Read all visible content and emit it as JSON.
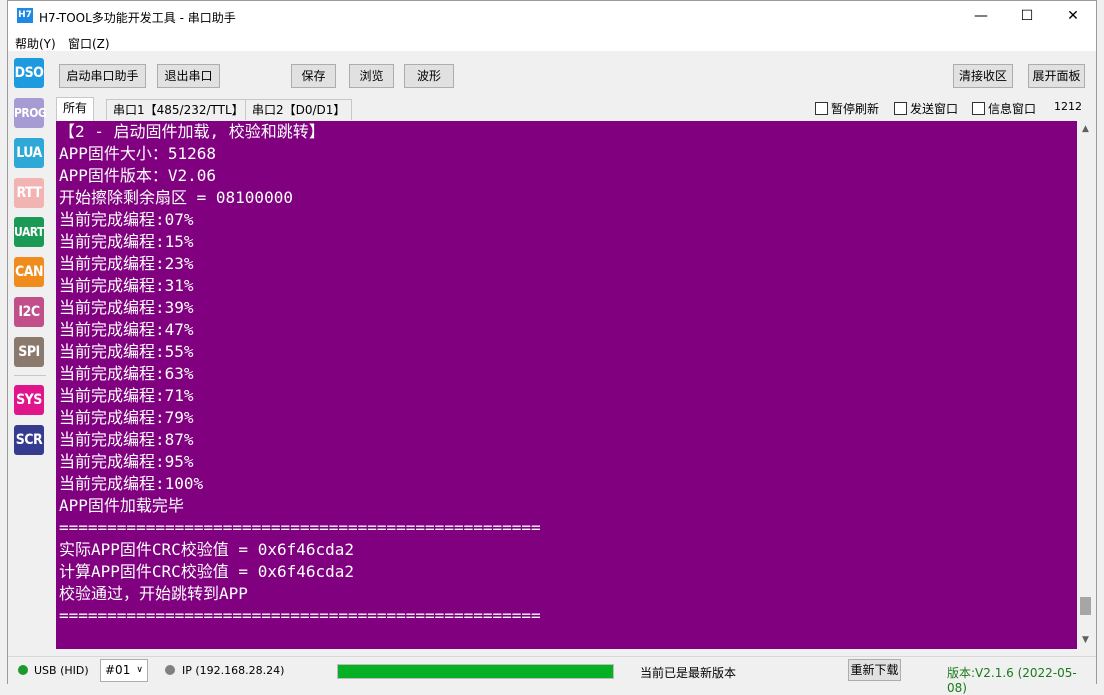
{
  "window": {
    "icon_text": "H7",
    "title": "H7-TOOL多功能开发工具 - 串口助手",
    "minimize": "—",
    "maximize": "☐",
    "close": "✕"
  },
  "menu": [
    "帮助(Y)",
    "窗口(Z)"
  ],
  "sidebar": [
    {
      "label": "DSO",
      "color": "#1e9be0"
    },
    {
      "label": "PROG",
      "color": "#a79bd4"
    },
    {
      "label": "LUA",
      "color": "#2ea8d6"
    },
    {
      "label": "RTT",
      "color": "#f2b3b3"
    },
    {
      "label": "UART",
      "color": "#1a9a55"
    },
    {
      "label": "CAN",
      "color": "#f08c1e"
    },
    {
      "label": "I2C",
      "color": "#c04f8a"
    },
    {
      "label": "SPI",
      "color": "#8a7a6e"
    },
    {
      "label": "SYS",
      "color": "#e0158c"
    },
    {
      "label": "SCR",
      "color": "#353c8f"
    }
  ],
  "toolbar": {
    "start": "启动串口助手",
    "exit": "退出串口",
    "save": "保存",
    "browse": "浏览",
    "wave": "波形",
    "clear": "清接收区",
    "expand": "展开面板"
  },
  "tabs": [
    "所有",
    "串口1【485/232/TTL】",
    "串口2【D0/D1】"
  ],
  "options": {
    "pause": "暂停刷新",
    "send_window": "发送窗口",
    "info_window": "信息窗口",
    "count": "1212"
  },
  "console": {
    "background": "#800080",
    "lines": [
      "【2 - 启动固件加载, 校验和跳转】",
      "APP固件大小：51268",
      "APP固件版本：V2.06",
      "开始擦除剩余扇区 = 08100000",
      "当前完成编程:07%",
      "当前完成编程:15%",
      "当前完成编程:23%",
      "当前完成编程:31%",
      "当前完成编程:39%",
      "当前完成编程:47%",
      "当前完成编程:55%",
      "当前完成编程:63%",
      "当前完成编程:71%",
      "当前完成编程:79%",
      "当前完成编程:87%",
      "当前完成编程:95%",
      "当前完成编程:100%",
      "APP固件加载完毕",
      "==================================================",
      "实际APP固件CRC校验值 = 0x6f46cda2",
      "计算APP固件CRC校验值 = 0x6f46cda2",
      "校验通过，开始跳转到APP",
      "=================================================="
    ]
  },
  "status": {
    "usb": "USB (HID)",
    "device": "#01",
    "ip": "IP (192.168.28.24)",
    "progress_fraction": 1.0,
    "message": "当前已是最新版本",
    "redownload": "重新下载",
    "version": "版本:V2.1.6 (2022-05-08)",
    "usb_color": "#1a9a2a",
    "ip_color": "#808080",
    "progress_color": "#06b025",
    "version_color": "#1a7a1a"
  }
}
